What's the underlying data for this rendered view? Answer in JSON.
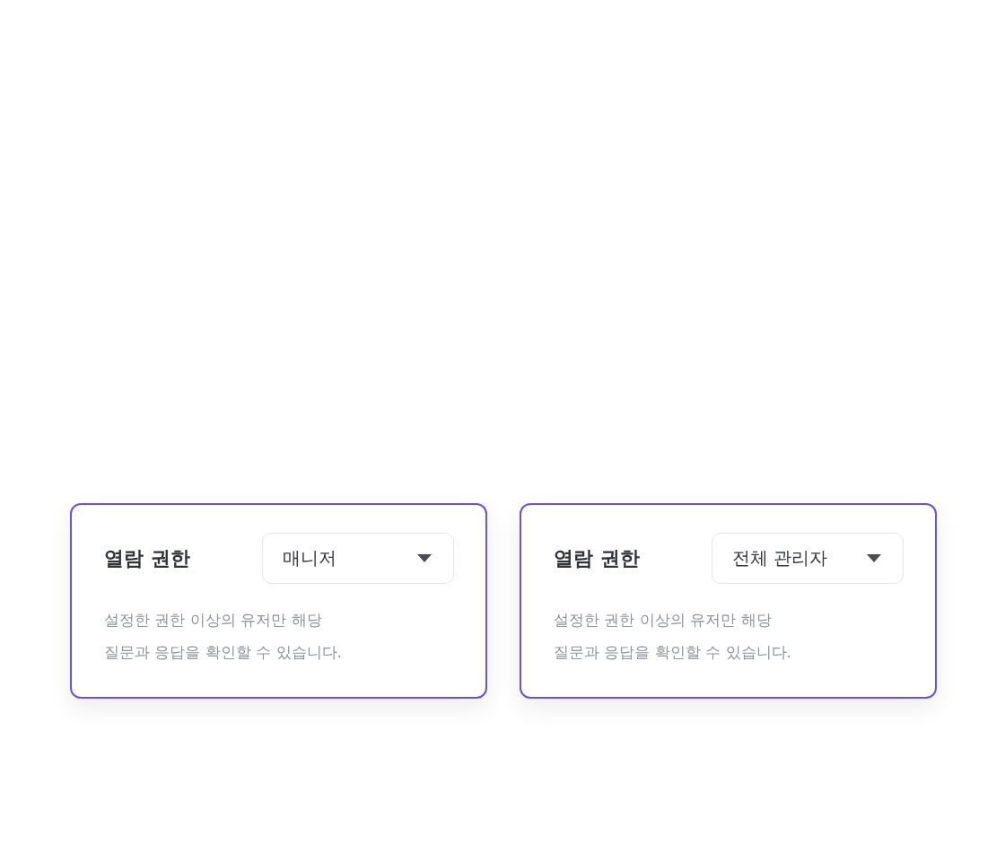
{
  "cards": [
    {
      "label": "열람 권한",
      "dropdown": {
        "value": "매니저"
      },
      "description": "설정한 권한 이상의 유저만 해당\n질문과 응답을 확인할 수 있습니다."
    },
    {
      "label": "열람 권한",
      "dropdown": {
        "value": "전체 관리자"
      },
      "description": "설정한 권한 이상의 유저만 해당\n질문과 응답을 확인할 수 있습니다."
    }
  ]
}
